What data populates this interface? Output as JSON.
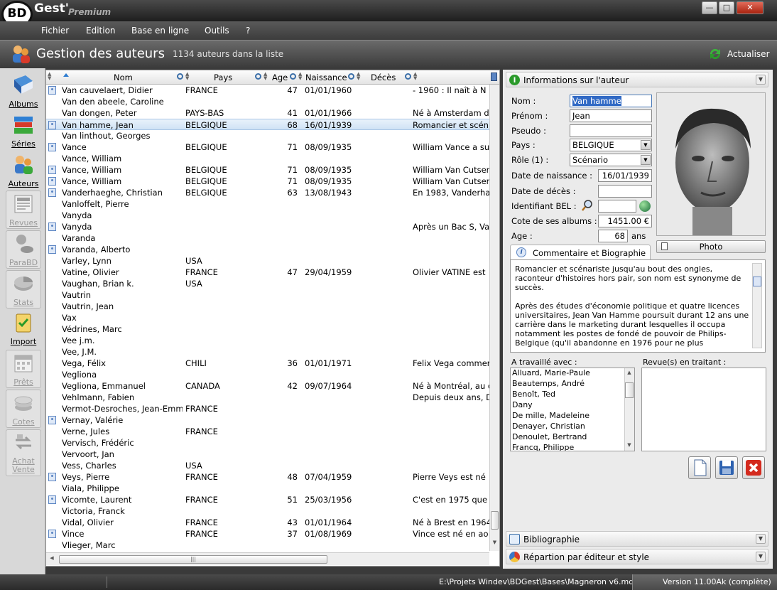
{
  "app": {
    "title": "Gest'",
    "logo_text": "BD",
    "edition": "Premium",
    "window_buttons": [
      "minimize",
      "maximize",
      "close"
    ]
  },
  "menu": [
    "Fichier",
    "Edition",
    "Base en ligne",
    "Outils",
    "?"
  ],
  "header": {
    "title": "Gestion des auteurs",
    "count": "1134 auteurs dans la liste",
    "refresh_label": "Actualiser"
  },
  "sidebar": [
    {
      "label": "Albums",
      "icon": "book-icon",
      "enabled": true
    },
    {
      "label": "Séries",
      "icon": "books-stack-icon",
      "enabled": true
    },
    {
      "label": "Auteurs",
      "icon": "people-icon",
      "enabled": true
    },
    {
      "label": "Revues",
      "icon": "newspaper-icon",
      "enabled": false
    },
    {
      "label": "ParaBD",
      "icon": "figurine-icon",
      "enabled": false
    },
    {
      "label": "Stats",
      "icon": "pie-chart-icon",
      "enabled": false
    },
    {
      "label": "Import",
      "icon": "clipboard-check-icon",
      "enabled": true
    },
    {
      "label": "Prêts",
      "icon": "calendar-icon",
      "enabled": false
    },
    {
      "label": "Cotes",
      "icon": "coins-icon",
      "enabled": false
    },
    {
      "label": "Achat\nVente",
      "icon": "exchange-icon",
      "enabled": false
    }
  ],
  "table": {
    "columns": [
      "Nom",
      "Pays",
      "Age",
      "Naissance",
      "Décès"
    ],
    "rows": [
      {
        "pic": true,
        "nom": "Van cauvelaert, Didier",
        "pays": "FRANCE",
        "age": "47",
        "naissance": "01/01/1960",
        "bio": "- 1960 : Il naît à N"
      },
      {
        "pic": false,
        "nom": "Van den abeele, Caroline",
        "pays": "",
        "age": "",
        "naissance": "",
        "bio": ""
      },
      {
        "pic": false,
        "nom": "Van dongen, Peter",
        "pays": "PAYS-BAS",
        "age": "41",
        "naissance": "01/01/1966",
        "bio": "Né à Amsterdam d"
      },
      {
        "pic": true,
        "nom": "Van hamme, Jean",
        "pays": "BELGIQUE",
        "age": "68",
        "naissance": "16/01/1939",
        "bio": "Romancier et scén",
        "selected": true
      },
      {
        "pic": false,
        "nom": "Van linthout, Georges",
        "pays": "",
        "age": "",
        "naissance": "",
        "bio": ""
      },
      {
        "pic": true,
        "nom": "Vance",
        "pays": "BELGIQUE",
        "age": "71",
        "naissance": "08/09/1935",
        "bio": "William Vance a su"
      },
      {
        "pic": false,
        "nom": "Vance, William",
        "pays": "",
        "age": "",
        "naissance": "",
        "bio": ""
      },
      {
        "pic": true,
        "nom": "Vance, William",
        "pays": "BELGIQUE",
        "age": "71",
        "naissance": "08/09/1935",
        "bio": "William Van Cutser"
      },
      {
        "pic": true,
        "nom": "Vance, William",
        "pays": "BELGIQUE",
        "age": "71",
        "naissance": "08/09/1935",
        "bio": "William Van Cutser"
      },
      {
        "pic": true,
        "nom": "Vanderhaeghe, Christian",
        "pays": "BELGIQUE",
        "age": "63",
        "naissance": "13/08/1943",
        "bio": "En 1983, Vanderha"
      },
      {
        "pic": false,
        "nom": "Vanloffelt, Pierre",
        "pays": "",
        "age": "",
        "naissance": "",
        "bio": ""
      },
      {
        "pic": false,
        "nom": "Vanyda",
        "pays": "",
        "age": "",
        "naissance": "",
        "bio": ""
      },
      {
        "pic": true,
        "nom": "Vanyda",
        "pays": "",
        "age": "",
        "naissance": "",
        "bio": "Après un Bac S, Va"
      },
      {
        "pic": false,
        "nom": "Varanda",
        "pays": "",
        "age": "",
        "naissance": "",
        "bio": ""
      },
      {
        "pic": true,
        "nom": "Varanda, Alberto",
        "pays": "",
        "age": "",
        "naissance": "",
        "bio": ""
      },
      {
        "pic": false,
        "nom": "Varley, Lynn",
        "pays": "USA",
        "age": "",
        "naissance": "",
        "bio": ""
      },
      {
        "pic": false,
        "nom": "Vatine, Olivier",
        "pays": "FRANCE",
        "age": "47",
        "naissance": "29/04/1959",
        "bio": "Olivier VATINE est"
      },
      {
        "pic": false,
        "nom": "Vaughan, Brian k.",
        "pays": "USA",
        "age": "",
        "naissance": "",
        "bio": ""
      },
      {
        "pic": false,
        "nom": "Vautrin",
        "pays": "",
        "age": "",
        "naissance": "",
        "bio": ""
      },
      {
        "pic": false,
        "nom": "Vautrin, Jean",
        "pays": "",
        "age": "",
        "naissance": "",
        "bio": ""
      },
      {
        "pic": false,
        "nom": "Vax",
        "pays": "",
        "age": "",
        "naissance": "",
        "bio": ""
      },
      {
        "pic": false,
        "nom": "Védrines, Marc",
        "pays": "",
        "age": "",
        "naissance": "",
        "bio": ""
      },
      {
        "pic": false,
        "nom": "Vee j.m.",
        "pays": "",
        "age": "",
        "naissance": "",
        "bio": ""
      },
      {
        "pic": false,
        "nom": "Vee, J.M.",
        "pays": "",
        "age": "",
        "naissance": "",
        "bio": ""
      },
      {
        "pic": false,
        "nom": "Vega, Félix",
        "pays": "CHILI",
        "age": "36",
        "naissance": "01/01/1971",
        "bio": "Felix Vega commer"
      },
      {
        "pic": false,
        "nom": "Vegliona",
        "pays": "",
        "age": "",
        "naissance": "",
        "bio": ""
      },
      {
        "pic": false,
        "nom": "Vegliona, Emmanuel",
        "pays": "CANADA",
        "age": "42",
        "naissance": "09/07/1964",
        "bio": "Né à Montréal, au c"
      },
      {
        "pic": false,
        "nom": "Vehlmann, Fabien",
        "pays": "",
        "age": "",
        "naissance": "",
        "bio": "Depuis deux ans, D"
      },
      {
        "pic": false,
        "nom": "Vermot-Desroches, Jean-Emm",
        "pays": "FRANCE",
        "age": "",
        "naissance": "",
        "bio": ""
      },
      {
        "pic": true,
        "nom": "Vernay, Valérie",
        "pays": "",
        "age": "",
        "naissance": "",
        "bio": ""
      },
      {
        "pic": false,
        "nom": "Verne, Jules",
        "pays": "FRANCE",
        "age": "",
        "naissance": "",
        "bio": ""
      },
      {
        "pic": false,
        "nom": "Vervisch, Frédéric",
        "pays": "",
        "age": "",
        "naissance": "",
        "bio": ""
      },
      {
        "pic": false,
        "nom": "Vervoort, Jan",
        "pays": "",
        "age": "",
        "naissance": "",
        "bio": ""
      },
      {
        "pic": false,
        "nom": "Vess, Charles",
        "pays": "USA",
        "age": "",
        "naissance": "",
        "bio": ""
      },
      {
        "pic": true,
        "nom": "Veys, Pierre",
        "pays": "FRANCE",
        "age": "48",
        "naissance": "07/04/1959",
        "bio": "Pierre Veys est né"
      },
      {
        "pic": false,
        "nom": "Viala, Philippe",
        "pays": "",
        "age": "",
        "naissance": "",
        "bio": ""
      },
      {
        "pic": true,
        "nom": "Vicomte, Laurent",
        "pays": "FRANCE",
        "age": "51",
        "naissance": "25/03/1956",
        "bio": "C'est en 1975 que"
      },
      {
        "pic": false,
        "nom": "Victoria, Franck",
        "pays": "",
        "age": "",
        "naissance": "",
        "bio": ""
      },
      {
        "pic": false,
        "nom": "Vidal, Olivier",
        "pays": "FRANCE",
        "age": "43",
        "naissance": "01/01/1964",
        "bio": "Né à Brest en 1964"
      },
      {
        "pic": true,
        "nom": "Vince",
        "pays": "FRANCE",
        "age": "37",
        "naissance": "01/08/1969",
        "bio": "Vince est né en ao"
      },
      {
        "pic": false,
        "nom": "Vlieger, Marc",
        "pays": "",
        "age": "",
        "naissance": "",
        "bio": ""
      }
    ]
  },
  "details": {
    "section_title": "Informations sur l'auteur",
    "labels": {
      "nom": "Nom :",
      "prenom": "Prénom :",
      "pseudo": "Pseudo :",
      "pays": "Pays :",
      "role": "Rôle (1) :",
      "naissance": "Date de naissance :",
      "deces": "Date de décès :",
      "bel": "Identifiant BEL :",
      "cote": "Cote de ses albums :",
      "age": "Age :",
      "ans": "ans"
    },
    "values": {
      "nom": "Van hamme",
      "prenom": "Jean",
      "pseudo": "",
      "pays": "BELGIQUE",
      "role": "Scénario",
      "naissance": "16/01/1939",
      "deces": "",
      "bel": "",
      "cote": "1451.00 €",
      "age": "68"
    },
    "photo_button": "Photo",
    "bio_tab": "Commentaire et Biographie",
    "bio_text": "Romancier et scénariste jusqu'au bout des ongles, raconteur d'histoires hors pair, son nom est synonyme de succès.\n\nAprès des études d'économie politique et quatre licences universitaires, Jean Van Hamme poursuit durant 12 ans une carrière dans le marketing durant lesquelles il occupa notamment les postes de fondé de pouvoir de Philips-Belgique (qu'il abandonne en 1976 pour ne plus",
    "worked_with_label": "A travaillé avec :",
    "worked_with": [
      "Alluard, Marie-Paule",
      "Beautemps, André",
      "Benoît, Ted",
      "Dany",
      "De mille, Madeleine",
      "Denayer, Christian",
      "Denoulet, Bertrand",
      "Francq, Philippe"
    ],
    "revues_label": "Revue(s) en traitant :",
    "bibliography": "Bibliographie",
    "repartition": "Répartion par éditeur et style"
  },
  "status": {
    "path": "E:\\Projets Windev\\BDGest\\Bases\\Magneron v6.mdb",
    "version": "Version 11.00Ak (complète)"
  },
  "colors": {
    "accent": "#2b7bd0",
    "selected_row": "#cfe2f5",
    "dark_chrome": "#3a3a3a"
  }
}
